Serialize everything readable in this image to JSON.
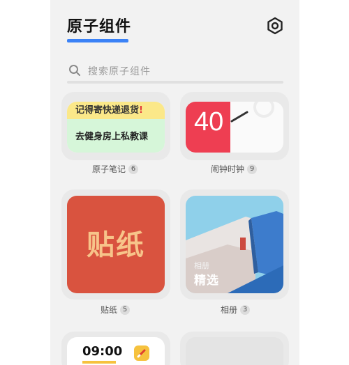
{
  "header": {
    "title": "原子组件"
  },
  "search": {
    "placeholder": "搜索原子组件"
  },
  "widgets": [
    {
      "name": "原子笔记",
      "count": "6",
      "preview": {
        "note1": "记得寄快递退货",
        "note1_mark": "!",
        "note2": "去健身房上私教课"
      }
    },
    {
      "name": "闹钟时钟",
      "count": "9",
      "preview": {
        "number": "40"
      }
    },
    {
      "name": "贴纸",
      "count": "5",
      "preview": {
        "text": "贴纸"
      }
    },
    {
      "name": "相册",
      "count": "3",
      "preview": {
        "subtitle": "相册",
        "title": "精选"
      }
    },
    {
      "name": "",
      "count": "",
      "preview": {
        "time": "09:00"
      }
    }
  ],
  "colors": {
    "accent": "#3b82f6",
    "clock_red": "#ee3e52",
    "sticker_red": "#d9533f",
    "note_yellow": "#fbe889",
    "note_green": "#d6f6d9",
    "time_yellow": "#f6c23e"
  },
  "icons": {
    "settings": "gear-icon",
    "search": "search-icon",
    "edit": "pencil-icon"
  }
}
